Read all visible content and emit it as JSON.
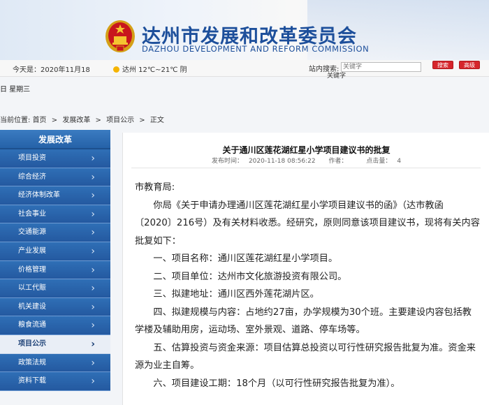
{
  "header": {
    "title": "达州市发展和改革委员会",
    "subtitle": "DAZHOU DEVELOPMENT AND REFORM COMMISSION"
  },
  "infobar": {
    "today": "今天是：2020年11月18",
    "weather": "达州 12℃~21℃ 阴",
    "weekday": "日 星期三",
    "search_label": "站内搜索:",
    "search_placeholder": "关键字",
    "search_button": "搜索",
    "advanced_button": "高级"
  },
  "breadcrumb": {
    "label": "当前位置:",
    "items": [
      "首页",
      "发展改革",
      "项目公示",
      "正文"
    ],
    "separator": ">"
  },
  "sidebar": {
    "heading": "发展改革",
    "items": [
      {
        "label": "项目投资",
        "active": false
      },
      {
        "label": "综合经济",
        "active": false
      },
      {
        "label": "经济体制改革",
        "active": false
      },
      {
        "label": "社会事业",
        "active": false
      },
      {
        "label": "交通能源",
        "active": false
      },
      {
        "label": "产业发展",
        "active": false
      },
      {
        "label": "价格管理",
        "active": false
      },
      {
        "label": "以工代赈",
        "active": false
      },
      {
        "label": "机关建设",
        "active": false
      },
      {
        "label": "粮食流通",
        "active": false
      },
      {
        "label": "项目公示",
        "active": true
      },
      {
        "label": "政策法规",
        "active": false
      },
      {
        "label": "资料下载",
        "active": false
      }
    ]
  },
  "article": {
    "title": "关于通川区莲花湖红星小学项目建议书的批复",
    "meta": {
      "published_label": "发布时间：",
      "published": "2020-11-18 08:56:22",
      "author_label": "作者：",
      "author": "",
      "views_label": "点击量：",
      "views": "4"
    },
    "salutation": "市教育局:",
    "p1": "你局《关于申请办理通川区莲花湖红星小学项目建议书的函》（达市教函〔2020〕216号）及有关材料收悉。经研究，原则同意该项目建议书，现将有关内容批复如下：",
    "item1": "一、项目名称：通川区莲花湖红星小学项目。",
    "item2": "二、项目单位：达州市文化旅游投资有限公司。",
    "item3": "三、拟建地址：通川区西外莲花湖片区。",
    "item4": "四、拟建规模与内容：占地约27亩，办学规模为30个班。主要建设内容包括教学楼及辅助用房，运动场、室外景观、道路、停车场等。",
    "item5": "五、估算投资与资金来源：项目估算总投资以可行性研究报告批复为准。资金来源为业主自筹。",
    "item6": "六、项目建设工期：18个月（以可行性研究报告批复为准）。"
  }
}
